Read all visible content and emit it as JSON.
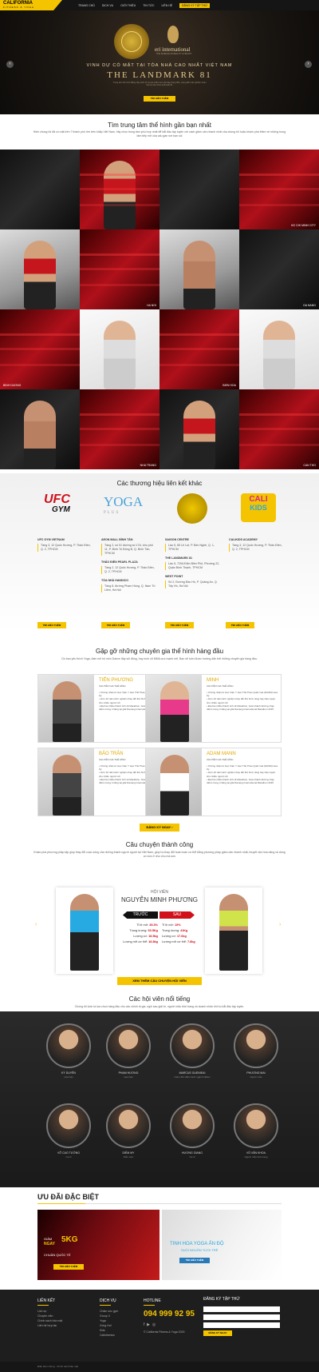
{
  "header": {
    "logo": "CALIFORNIA",
    "logo_sub": "FITNESS & YOGA",
    "nav": [
      "TRANG CHỦ",
      "DỊCH VỤ",
      "GIỚI THIỆU",
      "TIN TỨC",
      "LIÊN HỆ",
      "ĐĂNG KÝ TẬP THỬ"
    ]
  },
  "hero": {
    "brand": "eri international",
    "brand_sub": "THE SCIENCE OF BEAUTY & HEALTH",
    "line1": "VINH DỰ CÓ MẶT TẠI TÒA NHÀ CAO NHẤT VIỆT NAM",
    "line2": "THE LANDMARK 81",
    "line3": "Trung tâm thể hình đẳng cấp quốc tế và spa chăm sóc sắc đẹp hàng đầu, mang đến trải nghiệm hoàn hảo tại tòa nhà Landmark 81",
    "button": "TÌM HIỂU THÊM",
    "prev": "‹",
    "next": "›"
  },
  "centers": {
    "title": "Tìm trung tâm thể hình gần bạn nhất",
    "subtitle": "Hiện chúng tôi đã có mặt trên 7 thành phố lớn trên khắp Việt Nam, hãy chọn trung tâm phù hợp nhất để bắt đầu tập luyện với cách giảm cân nhanh nhất của chúng tôi hoặc khám phá thêm về những trung tâm tiếp mở của cấu gần nơi bạn sôi",
    "labels": [
      "HO CHI MINH CITY",
      "HA NOI",
      "DA NANG",
      "BINH DUONG",
      "BIEN HOA",
      "NHA TRANG",
      "CAN THO"
    ]
  },
  "brands": {
    "title": "Các thương hiệu liên kết khác",
    "ufc_top": "UFC",
    "ufc_bottom": "GYM",
    "yoga_top": "YOGA",
    "yoga_bottom": "PLUS",
    "cali_top": "CALI",
    "cali_bottom": "KIDS",
    "col1_h": "UFC GYM VIETNAM",
    "col1_a1": "Tầng 3, 12 Quốc Hương, P. Thảo Điền, Q. 2, TPHCM",
    "col2_h1": "AEON MALL BÌNH TÂN",
    "col2_a1": "Tầng 2, số 01 đường số 17A, khu phố 11, P. Bình Trị Đông B, Q. Bình Tân, TPHCM",
    "col2_h2": "THẢO ĐIỀN PEARL PLAZA",
    "col2_a2": "Tầng 2, 12 Quốc Hương, P. Thảo Điền, Q. 2, TPHCM",
    "col2_h3": "TÒA NHÀ HANDICO",
    "col2_a3": "Tầng 8, đường Phạm Hùng, Q. Nam Từ Liêm, Hà Nội",
    "col3_h1": "SAIGON CENTRE",
    "col3_a1": "Lầu 5, 65 Lê Lợi, P. Bến Nghé, Q. 1, TPHCM",
    "col3_h2": "THE LANDMARK 81",
    "col3_a2": "Lầu 5, 720A Điện Biên Phủ, Phường 22, Quận Bình Thạnh, TPHCM",
    "col3_h3": "WEST POINT",
    "col3_a3": "Số 2, Đường Đầu Hồ, P. Quảng An, Q. Tây Hồ, Hà Nội",
    "col4_h": "CALIKIDS ACADEMY",
    "col4_a1": "Tầng 3, 12 Quốc Hương, P. Thảo Điền, Q. 2, TPHCM",
    "button": "TÌM HIỂU THÊM"
  },
  "experts": {
    "title": "Gặp gỡ những chuyên gia thể hình hàng đầu",
    "subtitle": "Dù bạn yêu thích Yoga, đam mê bộ môn Dance đầy sôi động, hay môn võ MMA cực mạnh mẽ, Bạn sẽ luôn được hướng dẫn bởi những chuyên gia hàng đầu.",
    "cards": [
      {
        "name": "TIẾN PHƯƠNG",
        "role": "CHUYÊN GIA THỂ HÌNH",
        "b1": "Chứng nhận từ Học Viện Y Học Thể Thao Quốc Gia (NASM) Hoa Kỳ",
        "b2": "Hơn 10 năm kinh nghiệm thay đổi thể hình, tăng hay hiệu luyện cho nhiều người nổi",
        "b3": "Đạt hai nhiều thành tích về Marathon, hoàn thành đường chạy 42km trong 4 tiếng tại giải Danang International Marathon 2015"
      },
      {
        "name": "MINH",
        "role": "CHUYÊN GIA THỂ HÌNH",
        "b1": "Chứng nhận từ Học Viện Y Học Thể Thao Quốc Gia (NASM) Hoa Kỳ",
        "b2": "Hơn 10 năm kinh nghiệm thay đổi thể hình, tăng hay hiệu luyện cho nhiều người nổi",
        "b3": "Đạt hai nhiều thành tích về Marathon, hoàn thành đường chạy 42km trong 4 tiếng tại giải Danang International Marathon 2015"
      },
      {
        "name": "BẢO TRÂN",
        "role": "CHUYÊN GIA THỂ HÌNH",
        "b1": "Chứng nhận từ Học Viện Y Học Thể Thao Quốc Gia (NASM) Hoa Kỳ",
        "b2": "Hơn 10 năm kinh nghiệm thay đổi thể hình, tăng hay hiệu luyện cho nhiều người nổi",
        "b3": "Đạt hai nhiều thành tích về Marathon, hoàn thành đường chạy 42km trong 4 tiếng tại giải Danang International Marathon 2015"
      },
      {
        "name": "ADAM MANN",
        "role": "CHUYÊN GIA THỂ HÌNH",
        "b1": "Chứng nhận từ Học Viện Y Học Thể Thao Quốc Gia (NASM) Hoa Kỳ",
        "b2": "Hơn 10 năm kinh nghiệm thay đổi thể hình, tăng hay hiệu luyện cho nhiều người nổi",
        "b3": "Đạt hai nhiều thành tích về Marathon, hoàn thành đường chạy 42km trong 4 tiếng tại giải Danang International Marathon 2015"
      }
    ],
    "button": "ĐĂNG KÝ NGAY ›"
  },
  "story": {
    "title": "Câu chuyện thành công",
    "subtitle": "Khám phá phương pháp tập giúp thay đổi cuộc sống của những thành người người tại Việt Nam, giúp họ thay đổi hoàn toàn cơ thể bằng phương pháp giảm cân nhanh nhất, thuyết vận hóa năng và dùng có vừa ở như chu mà sức",
    "label": "HỘI VIÊN",
    "name": "NGUYỄN MINH PHƯƠNG",
    "before": "TRƯỚC",
    "after": "SAU",
    "before_stats": [
      {
        "k": "Tỉ lệ mỡ:",
        "v": "35.3%"
      },
      {
        "k": "Trọng lượng:",
        "v": "53.5Kg"
      },
      {
        "k": "Lượng cơ:",
        "v": "18.5kg"
      },
      {
        "k": "Lượng mỡ cơ thể:",
        "v": "18.8kg"
      }
    ],
    "after_stats": [
      {
        "k": "Tỉ lệ mỡ:",
        "v": "19%"
      },
      {
        "k": "Trọng lượng:",
        "v": "41Kg"
      },
      {
        "k": "Lượng cơ:",
        "v": "17.6kg"
      },
      {
        "k": "Lượng mỡ cơ thể:",
        "v": "7.8kg"
      }
    ],
    "button": "XEM THÊM CÂU CHUYỆN HỘI VIÊN",
    "prev": "‹",
    "next": "›"
  },
  "members": {
    "title": "Các hội viên nổi tiếng",
    "subtitle": "Chúng tôi luôn là lựa chọn hàng đầu cho các chính trị gia, ngôi sao giải trí, người mẫu thời trang và doanh nhân khi họ bắt đầu tập luyện.",
    "list": [
      {
        "name": "KỲ DUYÊN",
        "role": "Hoa hậu"
      },
      {
        "name": "PHẠM HƯƠNG",
        "role": "Hoa hậu"
      },
      {
        "name": "MARCUS GUENIEAI",
        "role": "Giám đốc điều hành ngành Nikkei"
      },
      {
        "name": "PHƯƠNG MAI",
        "role": "Người mẫu"
      },
      {
        "name": "VÕ CAO TƯỜNG",
        "role": "Ca sĩ"
      },
      {
        "name": "DIỄM MY",
        "role": "Diễn viên"
      },
      {
        "name": "HƯƠNG GIANG",
        "role": "Ca sĩ"
      },
      {
        "name": "VŨ VĂN KHOA",
        "role": "Người mẫu thời trang"
      }
    ]
  },
  "offers": {
    "title": "ƯU ĐÃI ĐẶC BIỆT",
    "p1_t1": "GIẢM",
    "p1_t2": "NGAY",
    "p1_t3": "5KG",
    "p1_t4": "CHUẨN QUỐC TẾ",
    "p2_t1": "TINH HOA YOGA ẤN ĐỘ",
    "p2_t2": "SUỐI NGUỒN TƯƠI TRẺ",
    "button": "TÌM HIỂU THÊM"
  },
  "footer": {
    "links_h": "LIÊN KẾT",
    "links": [
      "Lịch sự",
      "Chuyên viên",
      "Chính sách bảo mật",
      "Liên hệ hợp tác"
    ],
    "services_h": "DỊCH VỤ",
    "services": [
      "Chăm sóc gym",
      "Group X",
      "Yoga",
      "Xông Hơi",
      "Kids",
      "Calisthenics"
    ],
    "hotline_h": "HOTLINE",
    "hotline": "094 999 92 95",
    "copyright_small": "© California Fitness & Yoga 2015",
    "reg_h": "ĐĂNG KÝ TẬP THỬ",
    "reg_btn": "ĐĂNG KÝ NGAY",
    "bottom": "Điều kiện chung · Chính sách bảo mật"
  },
  "colors": {
    "accent": "#f5c400",
    "red": "#d0101a",
    "dark": "#1e1e1e"
  }
}
